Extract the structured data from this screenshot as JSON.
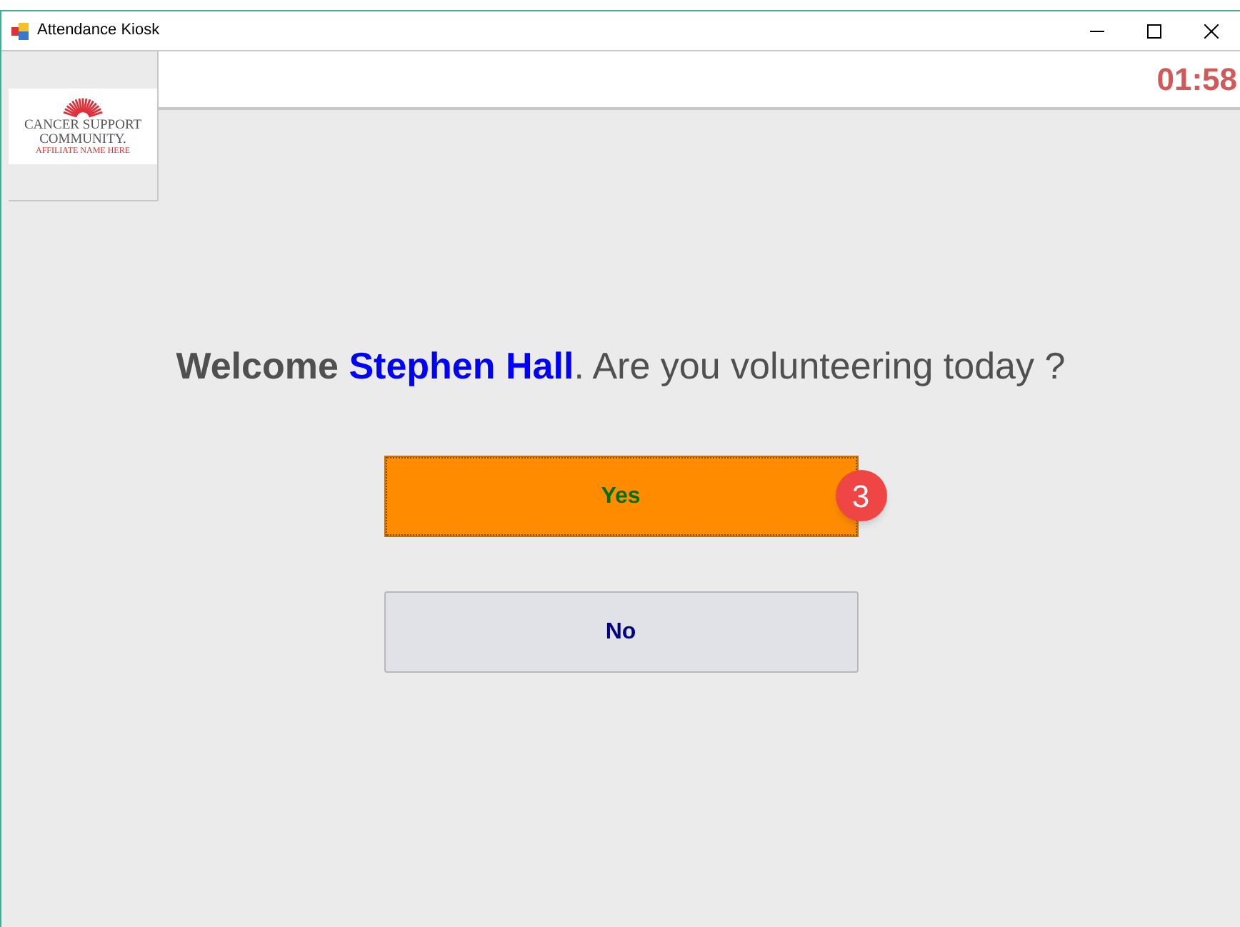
{
  "window": {
    "title": "Attendance Kiosk"
  },
  "logo": {
    "line_1": "CANCER SUPPORT",
    "line_2": "COMMUNITY.",
    "tagline": "AFFILIATE NAME HERE"
  },
  "timer": "01:58",
  "welcome": {
    "greeting": "Welcome",
    "name": "Stephen Hall",
    "question": ". Are you volunteering today ?"
  },
  "buttons": [
    {
      "label": "Yes",
      "kind": "primary",
      "badge": "3"
    },
    {
      "label": "No",
      "kind": "secondary"
    }
  ]
}
